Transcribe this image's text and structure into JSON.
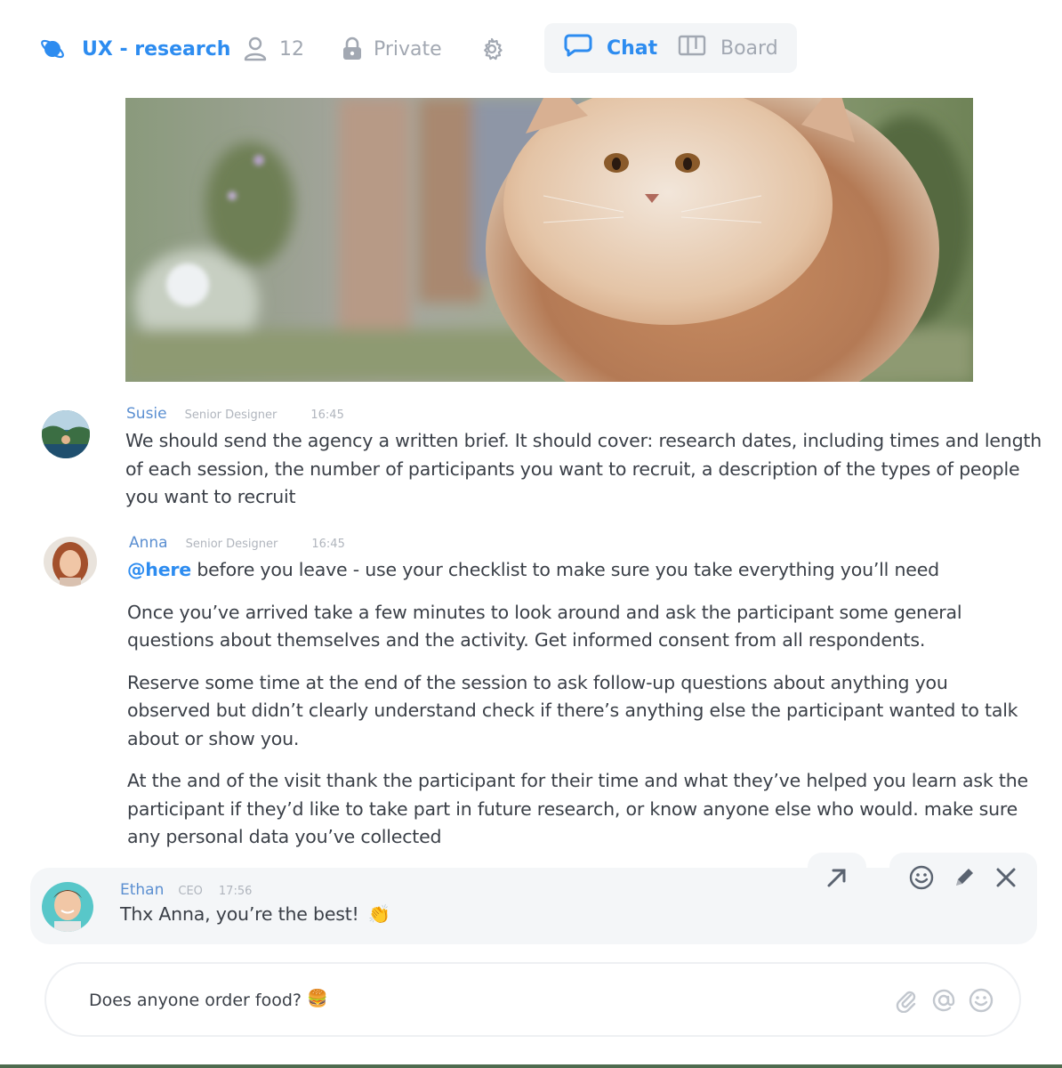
{
  "header": {
    "channel_name": "UX - research",
    "member_count": "12",
    "privacy_label": "Private",
    "tabs": [
      {
        "label": "Chat",
        "active": true
      },
      {
        "label": "Board",
        "active": false
      }
    ],
    "icons": {
      "channel": "planet-icon",
      "members": "user-icon",
      "privacy": "lock-icon",
      "settings": "gear-icon",
      "chat": "chat-bubble-icon",
      "board": "board-columns-icon"
    }
  },
  "hero_image": {
    "subject": "photo of a fluffy cat leaping toward the camera"
  },
  "messages": [
    {
      "author": "Susie",
      "role": "Senior Designer",
      "time": "16:45",
      "text": "We should send the agency a written brief. It should cover:  research dates, including times and length of each session, the number of participants you want to recruit, a description of the types of people you want to recruit"
    },
    {
      "author": "Anna",
      "role": "Senior Designer",
      "time": "16:45",
      "mention": "@here",
      "paragraphs": [
        " before you leave - use your checklist to make sure you take everything you’ll need",
        "Once you’ve arrived take a few minutes to look around and ask the participant some general questions about themselves and the activity. Get informed consent from all respondents.",
        "Reserve some time at the end of the session to ask follow-up questions about anything you observed but didn’t clearly understand check if there’s anything else the participant wanted to talk about or show you.",
        "At the and of the visit thank the participant for their time and what they’ve helped you learn ask the participant if they’d like to take part in future research, or know anyone else who would. make sure any personal data you’ve collected"
      ]
    },
    {
      "author": "Ethan",
      "role": "CEO",
      "time": "17:56",
      "text": "Thx Anna, you’re the best!",
      "emoji": "👏"
    }
  ],
  "message_actions": [
    "share-arrow-icon",
    "smiley-icon",
    "pencil-icon",
    "close-icon"
  ],
  "composer": {
    "value": "Does anyone order food?",
    "emoji": "🍔",
    "icons": [
      "paperclip-icon",
      "at-sign-icon",
      "smiley-icon"
    ]
  },
  "colors": {
    "accent": "#2d8cf0",
    "author": "#5b8fd1",
    "muted": "#a2a8b2",
    "text": "#3a3f47",
    "card_bg": "#f4f6f8"
  }
}
